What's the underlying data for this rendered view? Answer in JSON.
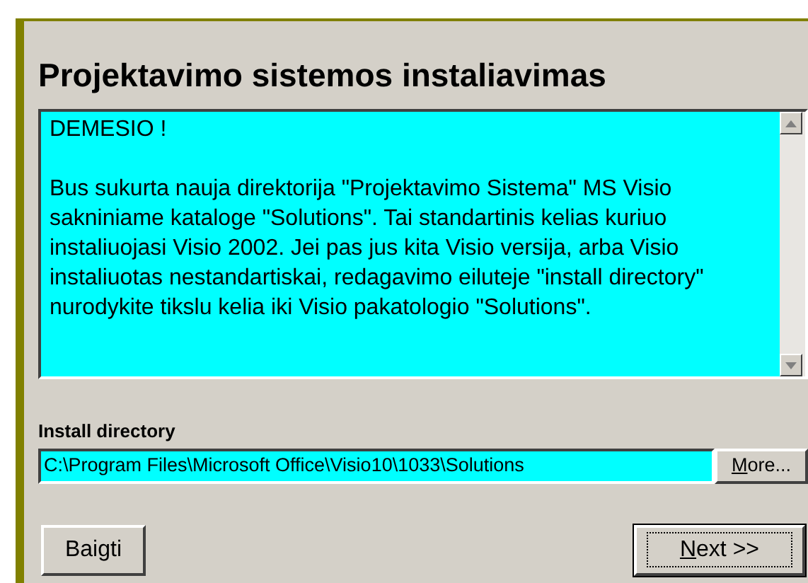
{
  "title": "Projektavimo sistemos instaliavimas",
  "notice": {
    "paragraphs": [
      "DEMESIO !",
      "Bus sukurta nauja direktorija \"Projektavimo Sistema\" MS Visio sakniniame kataloge \"Solutions\". Tai standartinis kelias kuriuo instaliuojasi Visio 2002. Jei pas jus kita Visio versija, arba Visio instaliuotas nestandartiskai, redagavimo eiluteje \"install directory\" nurodykite tikslu kelia iki Visio pakatologio \"Solutions\"."
    ]
  },
  "install_directory": {
    "label": "Install directory",
    "value": "C:\\Program Files\\Microsoft Office\\Visio10\\1033\\Solutions",
    "button": {
      "label": "More...",
      "underline_first": true
    }
  },
  "buttons": [
    {
      "label": "Baigti",
      "default": false,
      "underline_first": false
    },
    {
      "label": "Next >>",
      "default": true,
      "underline_first": true
    }
  ]
}
